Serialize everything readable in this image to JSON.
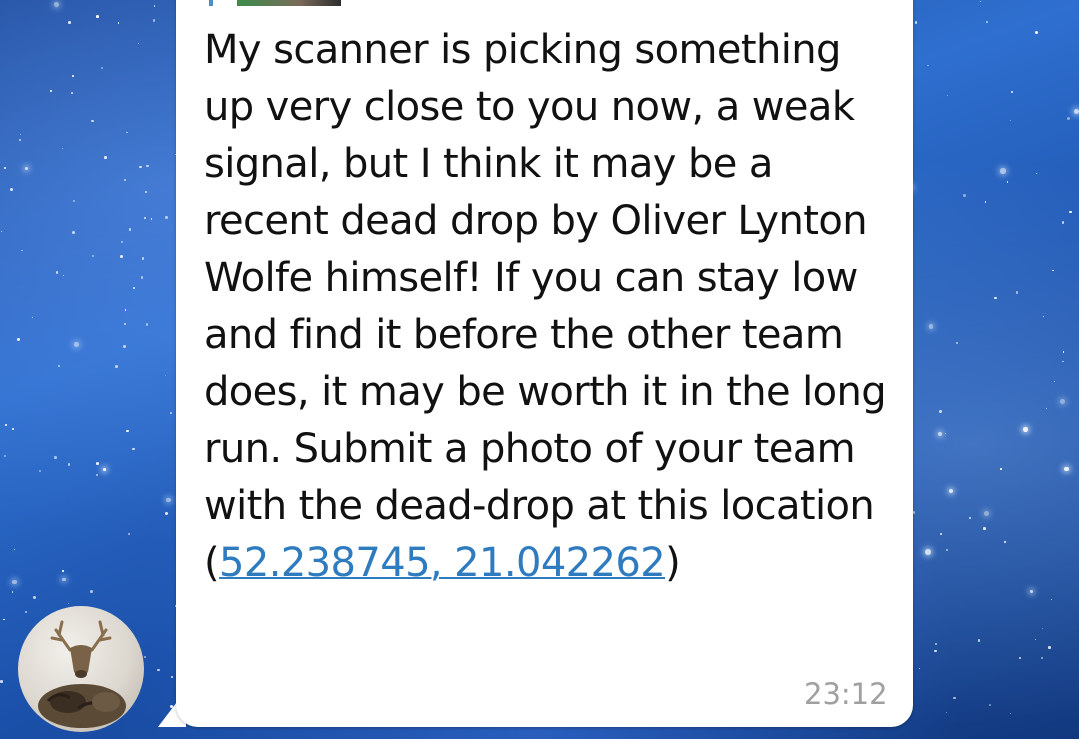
{
  "chat": {
    "message": {
      "text_before_link": "My scanner is picking something up very close to you now, a weak signal, but I think it may be a recent dead drop by Oliver Lynton Wolfe himself! If you can stay low and find it before the other team does, it may be worth it in the long run. Submit a photo of your team with the dead-drop at this location (",
      "link_text": "52.238745, 21.042262",
      "text_after_link": ")",
      "time": "23:12"
    },
    "avatar_icon": "deer-head-and-cat-avatar",
    "colors": {
      "bubble": "#ffffff",
      "link": "#2f7bbf",
      "timestamp": "#a0a0a0",
      "background": "#2f6fcf"
    }
  }
}
